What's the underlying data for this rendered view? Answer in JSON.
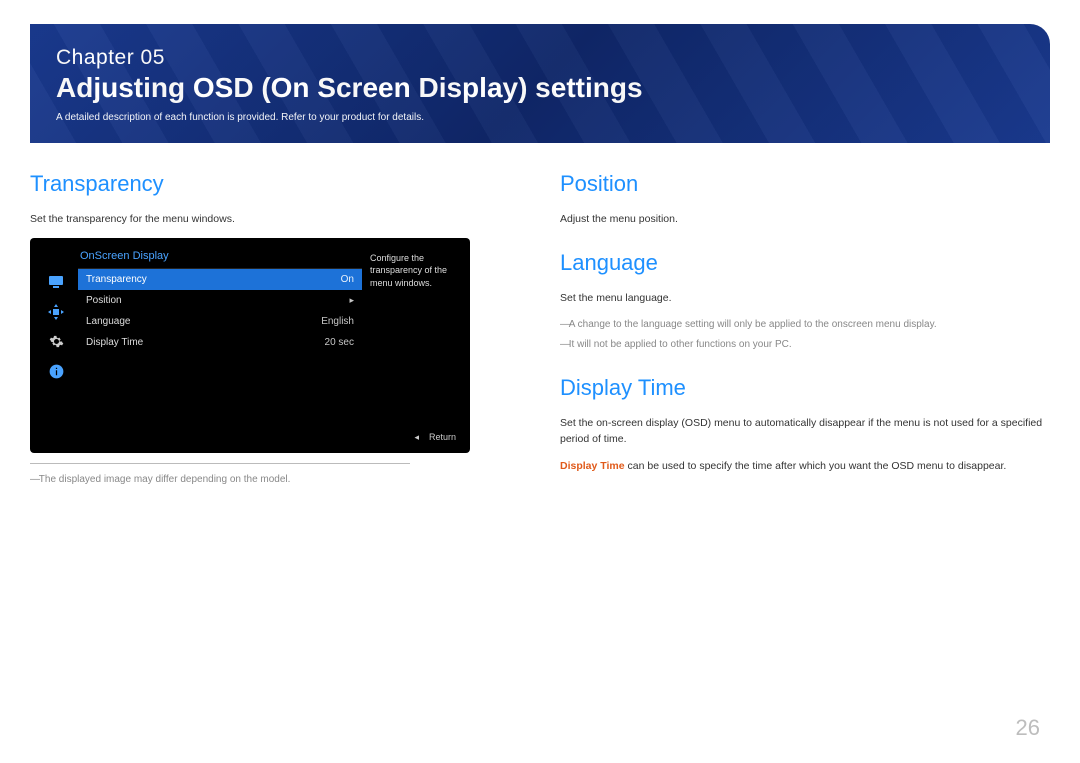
{
  "banner": {
    "chapter_label": "Chapter  05",
    "title": "Adjusting OSD (On Screen Display) settings",
    "desc": "A detailed description of each function is provided. Refer to your product for details."
  },
  "left": {
    "section": "Transparency",
    "desc": "Set the transparency for the menu windows.",
    "note": "The displayed image may differ depending on the model."
  },
  "osd": {
    "title": "OnScreen Display",
    "help": "Configure the transparency of the menu windows.",
    "rows": [
      {
        "label": "Transparency",
        "value": "On",
        "selected": true
      },
      {
        "label": "Position",
        "value": "▸",
        "selected": false
      },
      {
        "label": "Language",
        "value": "English",
        "selected": false
      },
      {
        "label": "Display Time",
        "value": "20 sec",
        "selected": false
      }
    ],
    "footer_back": "◂",
    "footer_return": "Return"
  },
  "right": {
    "position": {
      "h": "Position",
      "desc": "Adjust the menu position."
    },
    "language": {
      "h": "Language",
      "desc": "Set the menu language.",
      "note1": "A change to the language setting will only be applied to the onscreen menu display.",
      "note2": "It will not be applied to other functions on your PC."
    },
    "display_time": {
      "h": "Display Time",
      "desc1": "Set the on-screen display (OSD) menu to automatically disappear if the menu is not used for a specified period of time.",
      "hl": "Display Time",
      "desc2": " can be used to specify the time after which you want the OSD menu to disappear."
    }
  },
  "page_number": "26"
}
